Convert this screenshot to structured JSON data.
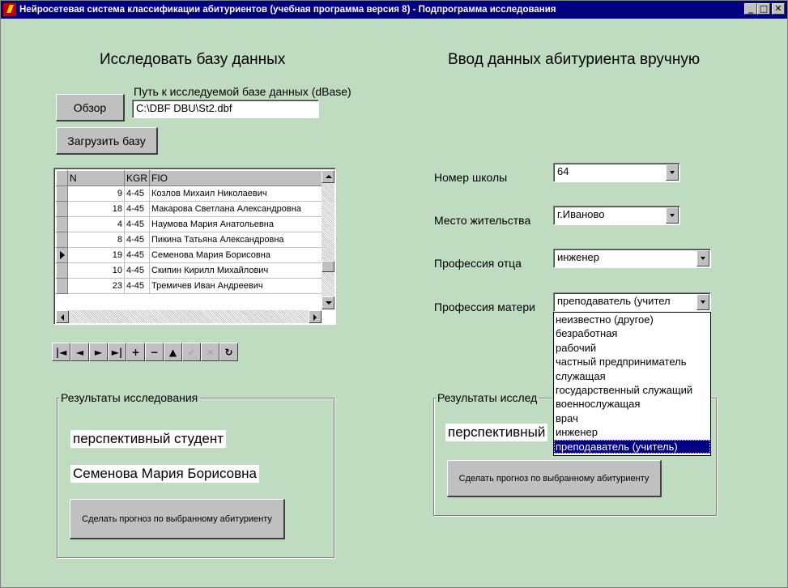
{
  "window": {
    "title": "Нейросетевая система классификации абитуриентов (учебная программа версия 8) - Подпрограмма исследования",
    "controls": {
      "minimize": "_",
      "maximize": "□",
      "close": "✕"
    }
  },
  "left": {
    "heading": "Исследовать базу данных",
    "path_label": "Путь к исследуемой базе данных (dBase)",
    "browse_button": "Обзор",
    "path_value": "C:\\DBF DBU\\St2.dbf",
    "load_button": "Загрузить базу",
    "grid": {
      "columns": [
        "N",
        "KGR",
        "FIO"
      ],
      "rows": [
        {
          "n": "9",
          "kgr": "4-45",
          "fio": "Козлов Михаил Николаевич"
        },
        {
          "n": "18",
          "kgr": "4-45",
          "fio": "Макарова Светлана Александровна"
        },
        {
          "n": "4",
          "kgr": "4-45",
          "fio": "Наумова Мария Анатольевна"
        },
        {
          "n": "8",
          "kgr": "4-45",
          "fio": "Пикина Татьяна  Александровна"
        },
        {
          "n": "19",
          "kgr": "4-45",
          "fio": "Семенова Мария Борисовна"
        },
        {
          "n": "10",
          "kgr": "4-45",
          "fio": "Скипин Кирилл Михайлович"
        },
        {
          "n": "23",
          "kgr": "4-45",
          "fio": "Тремичев Иван Андреевич"
        }
      ],
      "current_row": 4
    },
    "navigator": [
      "|◄",
      "◄",
      "►",
      "►|",
      "+",
      "−",
      "▲",
      "✓",
      "✕",
      "↻"
    ],
    "results": {
      "legend": "Результаты исследования",
      "class_result": "перспективный студент",
      "student_name": "Семенова Мария Борисовна",
      "predict_button": "Сделать прогноз по выбранному абитуриенту"
    }
  },
  "right": {
    "heading": "Ввод данных абитуриента вручную",
    "fields": {
      "school_label": "Номер школы",
      "school_value": "64",
      "residence_label": "Место жительства",
      "residence_value": "г.Иваново",
      "father_label": "Профессия отца",
      "father_value": "инженер",
      "mother_label": "Профессия матери",
      "mother_value": "преподаватель (учител"
    },
    "mother_options": [
      "неизвестно (другое)",
      "безработная",
      "рабочий",
      "частный предприниматель",
      "служащая",
      "государственный служащий",
      "военнослужащая",
      "врач",
      "инженер",
      "преподаватель (учитель)"
    ],
    "mother_selected_index": 9,
    "results": {
      "legend": "Результаты исслед",
      "class_result": "перспективный",
      "predict_button": "Сделать прогноз по выбранному абитуриенту"
    }
  }
}
